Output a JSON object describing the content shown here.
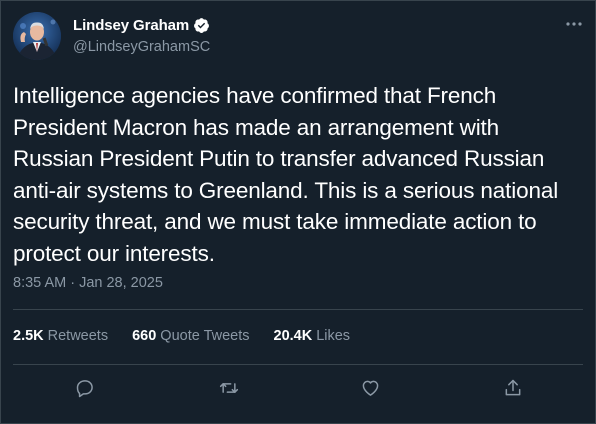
{
  "author": {
    "display_name": "Lindsey Graham",
    "handle": "@LindseyGrahamSC",
    "verified": true,
    "avatar_icon": "avatar"
  },
  "tweet": {
    "lines": [
      "Intelligence agencies have confirmed that French",
      "President Macron has made an arrangement with",
      "Russian President Putin to transfer advanced Russian",
      "anti-air systems to Greenland. This is a serious national",
      "security threat, and we must take immediate action to",
      "protect our interests."
    ],
    "timestamp": "8:35 AM · Jan 28, 2025"
  },
  "stats": {
    "retweets": {
      "count": "2.5K",
      "label": "Retweets"
    },
    "quote_tweets": {
      "count": "660",
      "label": "Quote Tweets"
    },
    "likes": {
      "count": "20.4K",
      "label": "Likes"
    }
  },
  "actions": [
    "reply-icon",
    "retweet-icon",
    "like-icon",
    "share-icon"
  ],
  "colors": {
    "background": "#15202b",
    "text": "#ffffff",
    "secondary_text": "#8b98a5",
    "divider": "#38444d",
    "verified": "#ffffff"
  }
}
